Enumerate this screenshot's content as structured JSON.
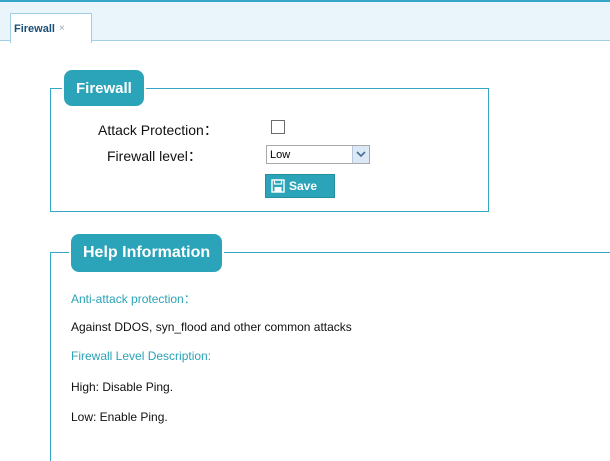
{
  "tabs": [
    {
      "label": "Firewall",
      "close": "×"
    }
  ],
  "firewall_panel": {
    "legend": "Firewall",
    "attack_protection_label": "Attack Protection：",
    "attack_protection_checked": false,
    "firewall_level_label": "Firewall level：",
    "firewall_level_value": "Low",
    "save_label": "Save"
  },
  "help_panel": {
    "legend": "Help Information",
    "anti_attack_heading": "Anti-attack protection：",
    "anti_attack_body": "Against DDOS, syn_flood and other common attacks",
    "level_heading": "Firewall Level Description:",
    "level_high": "High: Disable Ping.",
    "level_low": "Low: Enable Ping."
  },
  "colors": {
    "accent": "#2ba4ba",
    "border": "#35a6c6",
    "heading_text": "#2aa3b6"
  },
  "icons": {
    "save": "floppy-disk-icon",
    "dropdown": "chevron-down-icon",
    "tab_close": "close-icon"
  }
}
